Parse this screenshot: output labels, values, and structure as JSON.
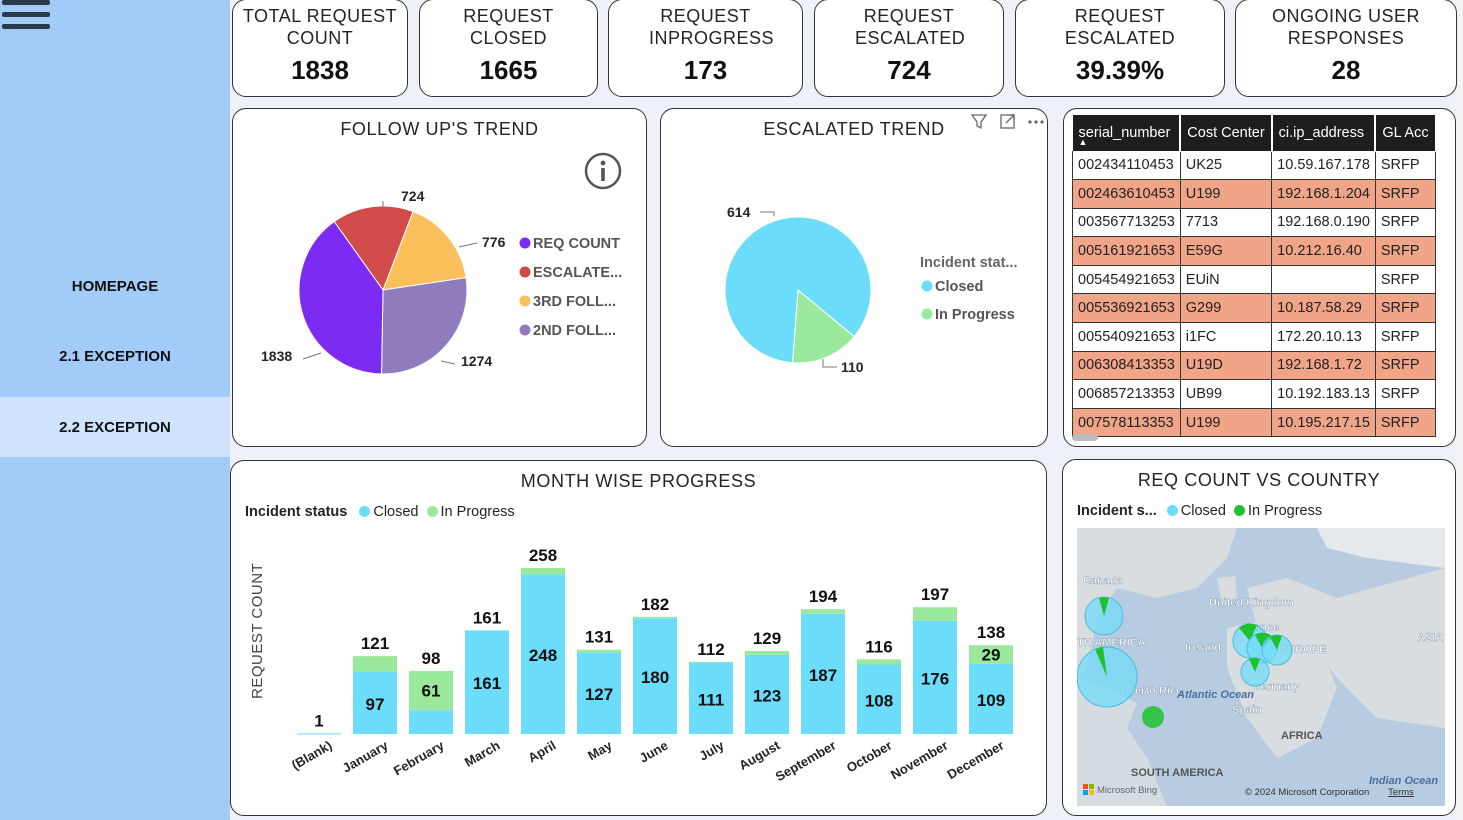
{
  "nav": {
    "items": [
      {
        "label": "HOMEPAGE"
      },
      {
        "label": "2.1 EXCEPTION"
      },
      {
        "label": "2.2 EXCEPTION"
      }
    ]
  },
  "kpis": [
    {
      "label": "TOTAL REQUEST COUNT",
      "value": "1838"
    },
    {
      "label": "REQUEST CLOSED",
      "value": "1665"
    },
    {
      "label": "REQUEST INPROGRESS",
      "value": "173"
    },
    {
      "label": "REQUEST ESCALATED",
      "value": "724"
    },
    {
      "label": "REQUEST ESCALATED",
      "value": "39.39%"
    },
    {
      "label": "ONGOING USER RESPONSES",
      "value": "28"
    }
  ],
  "followup": {
    "title": "FOLLOW UP'S TREND",
    "info_icon": "info-icon"
  },
  "escalated": {
    "title": "ESCALATED TREND",
    "toolbar_icons": [
      "filter-icon",
      "focus-mode-icon",
      "more-options-icon"
    ]
  },
  "table": {
    "columns": [
      "serial_number",
      "Cost Center",
      "ci.ip_address",
      "GL Acc"
    ],
    "rows": [
      [
        "002434110453",
        "UK25",
        "10.59.167.178",
        "SRFP"
      ],
      [
        "002463610453",
        "U199",
        "192.168.1.204",
        "SRFP"
      ],
      [
        "003567713253",
        "7713",
        "192.168.0.190",
        "SRFP"
      ],
      [
        "005161921653",
        "E59G",
        "10.212.16.40",
        "SRFP"
      ],
      [
        "005454921653",
        "EUiN",
        "",
        "SRFP"
      ],
      [
        "005536921653",
        "G299",
        "10.187.58.29",
        "SRFP"
      ],
      [
        "005540921653",
        "i1FC",
        "172.20.10.13",
        "SRFP"
      ],
      [
        "006308413353",
        "U19D",
        "192.168.1.72",
        "SRFP"
      ],
      [
        "006857213353",
        "UB99",
        "10.192.183.13",
        "SRFP"
      ],
      [
        "007578113353",
        "U199",
        "10.195.217.15",
        "SRFP"
      ]
    ],
    "highlight_color": "#f0a488"
  },
  "month": {
    "title": "MONTH WISE PROGRESS",
    "legend_title": "Incident status",
    "legend": [
      "Closed",
      "In Progress"
    ]
  },
  "map": {
    "title": "REQ COUNT VS COUNTRY",
    "legend_title": "Incident s...",
    "legend": [
      "Closed",
      "In Progress"
    ],
    "labels": [
      "Canada",
      "United Kingdom",
      "France",
      "TH AMERICA",
      "Ireland",
      "EUROPE",
      "ASIA",
      "Puerto Rico",
      "Atlantic Ocean",
      "Germany",
      "Spain",
      "AFRICA",
      "SOUTH AMERICA",
      "Indian Ocean"
    ],
    "bing": "Microsoft Bing",
    "copyright": "© 2024 Microsoft Corporation",
    "terms": "Terms"
  },
  "colors": {
    "closed": "#6cdcfb",
    "in_progress": "#99e89b",
    "map_in_progress": "#1fc22d",
    "req_count": "#7c2bf2",
    "escalated": "#d24b4b",
    "third": "#fbbf5c",
    "second": "#8e7cbf"
  },
  "chart_data": [
    {
      "type": "pie",
      "title": "FOLLOW UP'S TREND",
      "labels": [
        "REQ COUNT",
        "ESCALATE...",
        "3RD FOLL...",
        "2ND FOLL..."
      ],
      "values": [
        1838,
        724,
        776,
        1274
      ],
      "colors": [
        "#7c2bf2",
        "#d24b4b",
        "#fbbf5c",
        "#8e7cbf"
      ],
      "legend": "right"
    },
    {
      "type": "pie",
      "title": "ESCALATED TREND",
      "legend_title": "Incident stat...",
      "labels": [
        "Closed",
        "In Progress"
      ],
      "values": [
        614,
        110
      ],
      "colors": [
        "#6cdcfb",
        "#99e89b"
      ],
      "legend": "right"
    },
    {
      "type": "bar",
      "title": "MONTH WISE PROGRESS",
      "ylabel": "REQUEST COUNT",
      "categories": [
        "(Blank)",
        "January",
        "February",
        "March",
        "April",
        "May",
        "June",
        "July",
        "August",
        "September",
        "October",
        "November",
        "December"
      ],
      "totals": [
        1,
        121,
        98,
        161,
        258,
        131,
        182,
        112,
        129,
        194,
        116,
        197,
        138
      ],
      "series": [
        {
          "name": "Closed",
          "values": [
            1,
            97,
            37,
            161,
            248,
            127,
            180,
            111,
            123,
            187,
            108,
            176,
            109
          ]
        },
        {
          "name": "In Progress",
          "values": [
            0,
            24,
            61,
            0,
            10,
            4,
            2,
            1,
            6,
            7,
            8,
            21,
            29
          ]
        }
      ],
      "stacked": true,
      "legend": "top-left"
    }
  ]
}
